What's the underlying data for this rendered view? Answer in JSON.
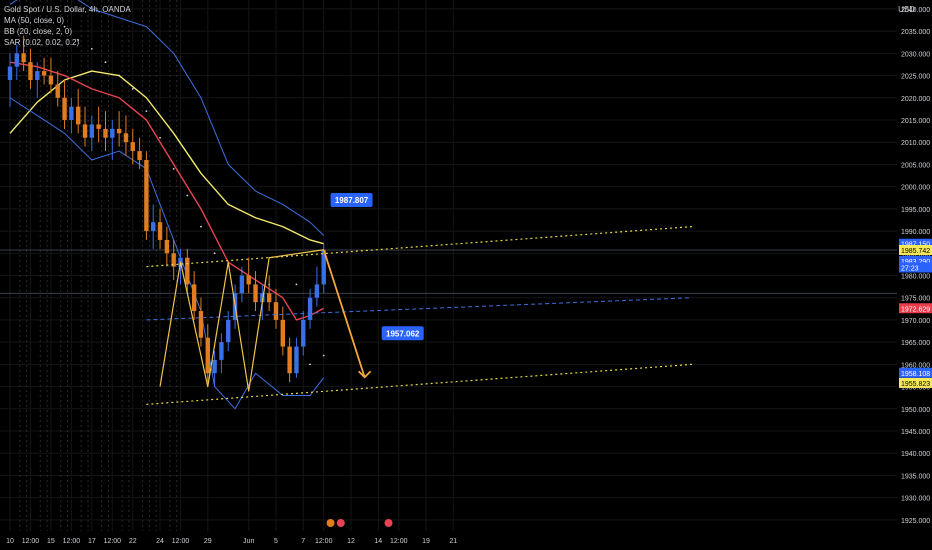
{
  "legend": {
    "line1": "Gold Spot / U.S. Dollar, 4h, OANDA",
    "line2": "MA (50, close, 0)",
    "line3": "BB (20, close, 2, 0)",
    "line4": "SAR (0.02, 0.02, 0.2)"
  },
  "currency": "USD",
  "chart_data": {
    "type": "candlestick",
    "symbol": "Gold Spot / U.S. Dollar",
    "interval": "4h",
    "source": "OANDA",
    "y_ticks": [
      1925,
      1930,
      1935,
      1940,
      1945,
      1950,
      1955,
      1960,
      1965,
      1970,
      1975,
      1980,
      1985,
      1990,
      1995,
      2000,
      2005,
      2010,
      2015,
      2020,
      2025,
      2030,
      2035,
      2040
    ],
    "ylim": [
      1922.5,
      2042
    ],
    "x_ticks": [
      {
        "label": "10",
        "i": 0
      },
      {
        "label": "12:00",
        "i": 3
      },
      {
        "label": "15",
        "i": 6
      },
      {
        "label": "12:00",
        "i": 9
      },
      {
        "label": "17",
        "i": 12
      },
      {
        "label": "12:00",
        "i": 15
      },
      {
        "label": "22",
        "i": 18
      },
      {
        "label": "24",
        "i": 22
      },
      {
        "label": "12:00",
        "i": 25
      },
      {
        "label": "29",
        "i": 29
      },
      {
        "label": "Jun",
        "i": 35
      },
      {
        "label": "5",
        "i": 39
      },
      {
        "label": "7",
        "i": 43
      },
      {
        "label": "12:00",
        "i": 46
      },
      {
        "label": "12",
        "i": 50
      },
      {
        "label": "14",
        "i": 54
      },
      {
        "label": "12:00",
        "i": 57
      },
      {
        "label": "19",
        "i": 61
      },
      {
        "label": "21",
        "i": 65
      }
    ],
    "candles": [
      [
        2024,
        2030,
        2018,
        2027
      ],
      [
        2027,
        2032,
        2024,
        2030
      ],
      [
        2030,
        2034,
        2026,
        2028
      ],
      [
        2028,
        2031,
        2022,
        2024
      ],
      [
        2024,
        2028,
        2020,
        2026
      ],
      [
        2026,
        2029,
        2023,
        2025
      ],
      [
        2025,
        2029,
        2021,
        2023
      ],
      [
        2023,
        2026,
        2018,
        2020
      ],
      [
        2020,
        2024,
        2013,
        2015
      ],
      [
        2015,
        2020,
        2012,
        2018
      ],
      [
        2018,
        2022,
        2012,
        2014
      ],
      [
        2014,
        2018,
        2009,
        2011
      ],
      [
        2011,
        2016,
        2008,
        2014
      ],
      [
        2014,
        2018,
        2010,
        2013
      ],
      [
        2013,
        2017,
        2008,
        2011
      ],
      [
        2011,
        2015,
        2006,
        2013
      ],
      [
        2013,
        2017,
        2009,
        2012
      ],
      [
        2012,
        2016,
        2007,
        2010
      ],
      [
        2010,
        2013,
        2005,
        2008
      ],
      [
        2008,
        2011,
        2004,
        2006
      ],
      [
        2006,
        2008,
        1988,
        1990
      ],
      [
        1990,
        1996,
        1986,
        1992
      ],
      [
        1992,
        1995,
        1986,
        1988
      ],
      [
        1988,
        1991,
        1982,
        1985
      ],
      [
        1985,
        1988,
        1979,
        1982
      ],
      [
        1982,
        1986,
        1978,
        1984
      ],
      [
        1984,
        1986,
        1976,
        1978
      ],
      [
        1978,
        1981,
        1970,
        1972
      ],
      [
        1972,
        1975,
        1964,
        1966
      ],
      [
        1966,
        1969,
        1956,
        1958
      ],
      [
        1958,
        1963,
        1955,
        1961
      ],
      [
        1961,
        1967,
        1958,
        1965
      ],
      [
        1965,
        1972,
        1963,
        1970
      ],
      [
        1970,
        1978,
        1968,
        1976
      ],
      [
        1976,
        1982,
        1974,
        1980
      ],
      [
        1980,
        1984,
        1976,
        1978
      ],
      [
        1978,
        1981,
        1972,
        1974
      ],
      [
        1974,
        1978,
        1970,
        1976
      ],
      [
        1976,
        1980,
        1972,
        1974
      ],
      [
        1974,
        1977,
        1968,
        1970
      ],
      [
        1970,
        1973,
        1962,
        1964
      ],
      [
        1964,
        1966,
        1956,
        1958
      ],
      [
        1958,
        1966,
        1957,
        1964
      ],
      [
        1964,
        1972,
        1962,
        1970
      ],
      [
        1970,
        1977,
        1968,
        1975
      ],
      [
        1975,
        1982,
        1973,
        1978
      ],
      [
        1978,
        1987,
        1976,
        1985.742
      ]
    ],
    "series": [
      {
        "name": "MA (50, close, 0)",
        "color": "#f2ea6b",
        "points": [
          [
            0,
            2012
          ],
          [
            4,
            2019
          ],
          [
            8,
            2024
          ],
          [
            12,
            2026
          ],
          [
            16,
            2025
          ],
          [
            20,
            2020
          ],
          [
            24,
            2012
          ],
          [
            28,
            2003
          ],
          [
            32,
            1996
          ],
          [
            36,
            1993
          ],
          [
            40,
            1991
          ],
          [
            44,
            1988
          ],
          [
            46,
            1987.15
          ]
        ]
      },
      {
        "name": "BB (20, close, 2, 0) basis",
        "color": "#e94352",
        "points": [
          [
            0,
            2028
          ],
          [
            4,
            2027
          ],
          [
            8,
            2025
          ],
          [
            12,
            2022
          ],
          [
            16,
            2020
          ],
          [
            20,
            2015
          ],
          [
            24,
            2005
          ],
          [
            28,
            1995
          ],
          [
            32,
            1983
          ],
          [
            36,
            1979
          ],
          [
            40,
            1975
          ],
          [
            42,
            1970
          ],
          [
            44,
            1971
          ],
          [
            46,
            1972.629
          ]
        ]
      },
      {
        "name": "BB (20, close, 2, 0) upper",
        "color": "#3f6fe0",
        "points": [
          [
            0,
            2041
          ],
          [
            4,
            2045
          ],
          [
            8,
            2044
          ],
          [
            12,
            2040
          ],
          [
            16,
            2038
          ],
          [
            20,
            2036
          ],
          [
            24,
            2030
          ],
          [
            28,
            2020
          ],
          [
            32,
            2005
          ],
          [
            36,
            1999
          ],
          [
            40,
            1996
          ],
          [
            44,
            1992
          ],
          [
            46,
            1989
          ]
        ]
      },
      {
        "name": "BB (20, close, 2, 0) lower",
        "color": "#3f6fe0",
        "points": [
          [
            0,
            2020
          ],
          [
            4,
            2016
          ],
          [
            8,
            2012
          ],
          [
            12,
            2006
          ],
          [
            16,
            2008
          ],
          [
            20,
            2004
          ],
          [
            24,
            1988
          ],
          [
            28,
            1972
          ],
          [
            30,
            1955
          ],
          [
            33,
            1950
          ],
          [
            36,
            1958
          ],
          [
            40,
            1953
          ],
          [
            44,
            1953
          ],
          [
            46,
            1957
          ]
        ]
      }
    ],
    "sar_points": [
      [
        8,
        2036
      ],
      [
        10,
        2033
      ],
      [
        12,
        2031
      ],
      [
        14,
        2028
      ],
      [
        16,
        2025
      ],
      [
        18,
        2022
      ],
      [
        20,
        2017
      ],
      [
        22,
        2011
      ],
      [
        24,
        2004
      ],
      [
        26,
        1998
      ],
      [
        28,
        1991
      ],
      [
        30,
        1985
      ],
      [
        34,
        1981
      ],
      [
        38,
        1978
      ],
      [
        42,
        1978
      ],
      [
        44,
        1960
      ],
      [
        46,
        1962
      ]
    ],
    "channel": {
      "upper": [
        [
          20,
          1982
        ],
        [
          100,
          1991
        ]
      ],
      "middle": [
        [
          20,
          1970
        ],
        [
          100,
          1975
        ]
      ],
      "lower": [
        [
          20,
          1951
        ],
        [
          100,
          1960
        ]
      ],
      "color": "#e5d842"
    },
    "zigzag": {
      "points": [
        [
          22,
          1955
        ],
        [
          25,
          1983
        ],
        [
          29,
          1955
        ],
        [
          32,
          1983
        ],
        [
          35,
          1954
        ],
        [
          38,
          1984
        ],
        [
          46,
          1985.8
        ]
      ],
      "color": "#f0c54a"
    },
    "projection": {
      "points": [
        [
          46,
          1985.8
        ],
        [
          52,
          1957.1
        ]
      ],
      "color": "#f2a93b"
    },
    "horizontal_lines": [
      1985.742,
      1976
    ],
    "callouts": [
      {
        "label": "1987.807",
        "value": 1987.807
      },
      {
        "label": "1957.062",
        "value": 1957.062
      }
    ],
    "price_labels": [
      {
        "text": "1987.150",
        "bg": "#2962ff",
        "color": "#ffffff",
        "value": 1987.15
      },
      {
        "text": "1985.742",
        "bg": "#f7e95a",
        "color": "#000000",
        "value": 1985.742
      },
      {
        "text": "1983.290",
        "bg": "#2962ff",
        "color": "#ffffff",
        "value": 1983.29
      },
      {
        "text": "27:23",
        "bg": "#2962ff",
        "color": "#ffffff",
        "value": 1981.8
      },
      {
        "text": "1972.629",
        "bg": "#e93d4a",
        "color": "#ffffff",
        "value": 1972.629
      },
      {
        "text": "1958.108",
        "bg": "#2962ff",
        "color": "#ffffff",
        "value": 1958.108
      },
      {
        "text": "1955.823",
        "bg": "#f7e95a",
        "color": "#000000",
        "value": 1955.823
      }
    ],
    "colors": {
      "up": "#3a6fe6",
      "down": "#e07d22",
      "background": "#000000",
      "grid": "#151515",
      "text": "#cfd2d8"
    }
  }
}
